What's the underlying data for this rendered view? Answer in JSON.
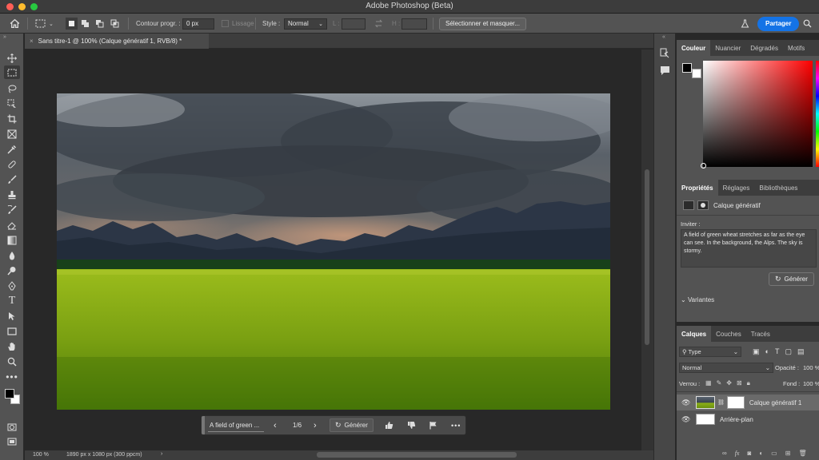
{
  "app": {
    "title": "Adobe Photoshop (Beta)"
  },
  "options_bar": {
    "contour_label": "Contour progr. :",
    "contour_value": "0 px",
    "lissage_label": "Lissage",
    "style_label": "Style :",
    "style_value": "Normal",
    "width_label": "L :",
    "height_label": "H :",
    "select_mask_button": "Sélectionner et masquer...",
    "share_button": "Partager"
  },
  "document": {
    "tab_title": "Sans titre-1 @ 100% (Calque génératif 1, RVB/8) *"
  },
  "status": {
    "zoom": "100 %",
    "doc_info": "1890 px x 1080 px (300 ppcm)"
  },
  "contextual_bar": {
    "prompt_preview": "A field of green ...",
    "variant_counter": "1/6",
    "generate_label": "Générer"
  },
  "color_panel": {
    "tabs": [
      "Couleur",
      "Nuancier",
      "Dégradés",
      "Motifs"
    ],
    "hue_color": "#ff0000"
  },
  "properties_panel": {
    "tabs": [
      "Propriétés",
      "Réglages",
      "Bibliothèques"
    ],
    "layer_type": "Calque génératif",
    "prompt_label": "Inviter :",
    "prompt_text": "A field of green wheat stretches as far as the eye can see. In the background, the Alps. The sky is stormy.",
    "generate_label": "Générer",
    "variants_label": "Variantes"
  },
  "layers_panel": {
    "tabs": [
      "Calques",
      "Couches",
      "Tracés"
    ],
    "filter_value": "Type",
    "blend_mode": "Normal",
    "opacity_label": "Opacité :",
    "opacity_value": "100 %",
    "lock_label": "Verrou :",
    "fill_label": "Fond :",
    "fill_value": "100 %",
    "layers": [
      {
        "name": "Calque génératif 1"
      },
      {
        "name": "Arrière-plan"
      }
    ]
  }
}
